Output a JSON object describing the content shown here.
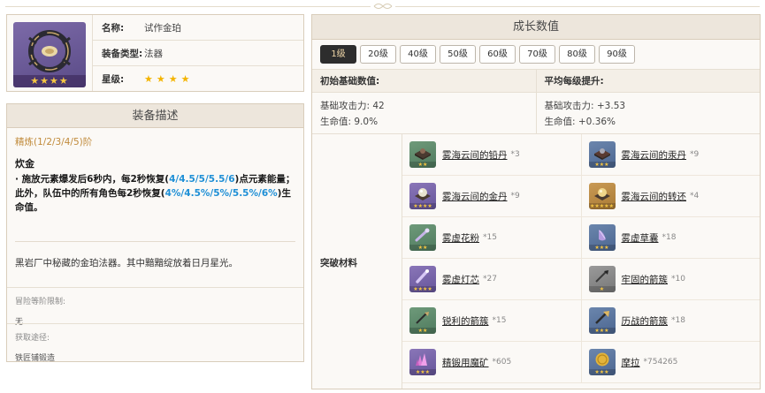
{
  "item": {
    "name_label": "名称:",
    "name": "试作金珀",
    "type_label": "装备类型:",
    "type": "法器",
    "rarity_label": "星级:",
    "rarity": 4,
    "icon": "catalyst-ring-icon",
    "stars_text": "★★★★"
  },
  "description": {
    "header": "装备描述",
    "refine": "精炼(1/2/3/4/5)阶",
    "effect_name": "炊金",
    "effect_p1": "· 施放元素爆发后6秒内，每2秒恢复(",
    "effect_hl1": "4/4.5/5/5.5/6",
    "effect_p2": ")点元素能量；此外，队伍中的所有角色每2秒恢复(",
    "effect_hl2": "4%/4.5%/5%/5.5%/6%",
    "effect_p3": ")生命值。",
    "flavor": "黑岩厂中秘藏的金珀法器。其中黯黯绽放着日月星光。",
    "ascension_limit_label": "冒险等阶限制:",
    "ascension_limit_value": "无",
    "source_label": "获取途径:",
    "source_value": "铁匠铺锻造"
  },
  "growth": {
    "header": "成长数值",
    "levels": [
      "1级",
      "20级",
      "40级",
      "50级",
      "60级",
      "70级",
      "80级",
      "90级"
    ],
    "active_level": "1级",
    "base_header": "初始基础数值:",
    "per_level_header": "平均每级提升:",
    "base_atk": "基础攻击力: 42",
    "base_hp": "生命值: 9.0%",
    "inc_atk": "基础攻击力: +3.53",
    "inc_hp": "生命值: +0.36%",
    "materials_label": "突破材料",
    "materials": [
      {
        "name": "雾海云间的铅丹",
        "count": "*3",
        "icon": "lead-block-icon",
        "rarity": 2
      },
      {
        "name": "雾海云间的汞丹",
        "count": "*9",
        "icon": "mercury-block-icon",
        "rarity": 3
      },
      {
        "name": "雾海云间的金丹",
        "count": "*9",
        "icon": "gold-pill-icon",
        "rarity": 4
      },
      {
        "name": "雾海云间的转还",
        "count": "*4",
        "icon": "golden-pearl-icon",
        "rarity": 5
      },
      {
        "name": "雾虚花粉",
        "count": "*15",
        "icon": "pollen-icon",
        "rarity": 2
      },
      {
        "name": "雾虚草囊",
        "count": "*18",
        "icon": "grass-sac-icon",
        "rarity": 3
      },
      {
        "name": "雾虚灯芯",
        "count": "*27",
        "icon": "lamp-wick-icon",
        "rarity": 4
      },
      {
        "name": "牢固的箭簇",
        "count": "*10",
        "icon": "arrowhead-icon",
        "rarity": 1
      },
      {
        "name": "锐利的箭簇",
        "count": "*15",
        "icon": "sharp-arrowhead-icon",
        "rarity": 2
      },
      {
        "name": "历战的箭簇",
        "count": "*18",
        "icon": "weathered-arrowhead-icon",
        "rarity": 3
      },
      {
        "name": "精锻用魔矿",
        "count": "*605",
        "icon": "magic-ore-icon",
        "rarity": 3
      },
      {
        "name": "摩拉",
        "count": "*754265",
        "icon": "mora-coin-icon",
        "rarity": 3
      }
    ]
  },
  "colors": {
    "highlight": "#1e8fd6",
    "refine": "#c08a3a",
    "active_level_bg": "#2d2d2d",
    "star": "#f4b400"
  }
}
